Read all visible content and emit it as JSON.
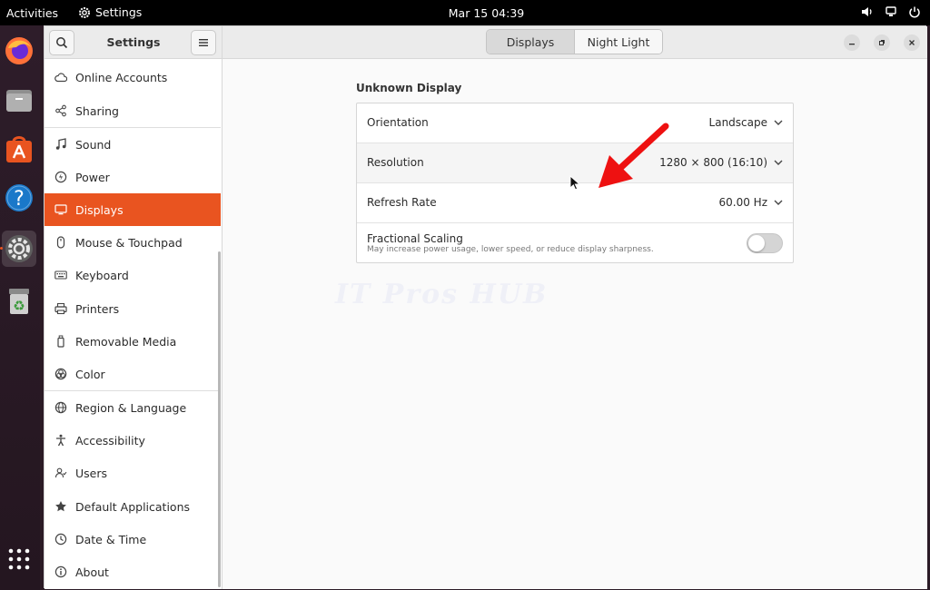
{
  "topbar": {
    "activities": "Activities",
    "app_name": "Settings",
    "clock": "Mar 15  04:39",
    "icons": [
      "volume-icon",
      "network-icon",
      "power-icon"
    ]
  },
  "dock": {
    "items": [
      {
        "name": "firefox",
        "icon": "firefox-icon"
      },
      {
        "name": "files",
        "icon": "files-icon"
      },
      {
        "name": "software",
        "icon": "software-icon"
      },
      {
        "name": "help",
        "icon": "help-icon"
      },
      {
        "name": "settings",
        "icon": "settings-icon"
      },
      {
        "name": "trash",
        "icon": "trash-icon"
      },
      {
        "name": "app-grid",
        "icon": "app-grid-icon"
      }
    ],
    "accent": "#e95420"
  },
  "sidebar": {
    "title": "Settings",
    "items": [
      {
        "label": "Online Accounts",
        "icon": "cloud-icon"
      },
      {
        "label": "Sharing",
        "icon": "share-icon"
      },
      {
        "label": "Sound",
        "icon": "music-note-icon"
      },
      {
        "label": "Power",
        "icon": "power-icon"
      },
      {
        "label": "Displays",
        "icon": "monitor-icon",
        "active": true
      },
      {
        "label": "Mouse & Touchpad",
        "icon": "mouse-icon"
      },
      {
        "label": "Keyboard",
        "icon": "keyboard-icon"
      },
      {
        "label": "Printers",
        "icon": "printer-icon"
      },
      {
        "label": "Removable Media",
        "icon": "usb-drive-icon"
      },
      {
        "label": "Color",
        "icon": "color-icon"
      },
      {
        "label": "Region & Language",
        "icon": "globe-icon"
      },
      {
        "label": "Accessibility",
        "icon": "accessibility-icon"
      },
      {
        "label": "Users",
        "icon": "users-icon"
      },
      {
        "label": "Default Applications",
        "icon": "star-icon"
      },
      {
        "label": "Date & Time",
        "icon": "clock-icon"
      },
      {
        "label": "About",
        "icon": "info-icon"
      }
    ]
  },
  "header": {
    "tabs": [
      {
        "label": "Displays",
        "selected": true
      },
      {
        "label": "Night Light",
        "selected": false
      }
    ]
  },
  "display": {
    "section_title": "Unknown Display",
    "orientation": {
      "label": "Orientation",
      "value": "Landscape"
    },
    "resolution": {
      "label": "Resolution",
      "value": "1280 × 800 (16:10)"
    },
    "refresh_rate": {
      "label": "Refresh Rate",
      "value": "60.00 Hz"
    },
    "fractional_scaling": {
      "label": "Fractional Scaling",
      "description": "May increase power usage, lower speed, or reduce display sharpness.",
      "enabled": false
    }
  },
  "watermark": "IT Pros HUB",
  "annotation_color": "#ee1111"
}
